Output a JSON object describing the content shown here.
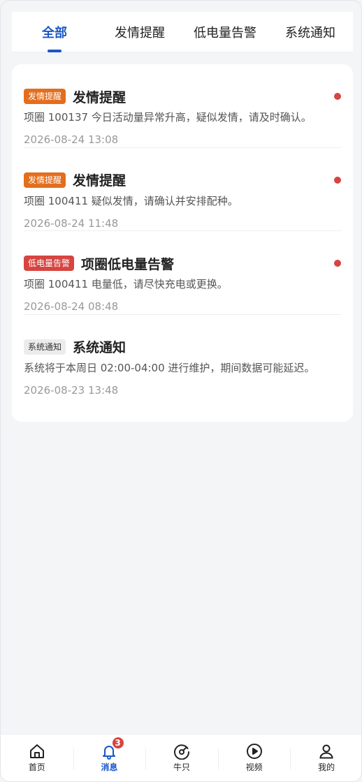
{
  "tabs": [
    {
      "label": "全部",
      "active": true
    },
    {
      "label": "发情提醒",
      "active": false
    },
    {
      "label": "低电量告警",
      "active": false
    },
    {
      "label": "系统通知",
      "active": false
    }
  ],
  "messages": [
    {
      "tag": "发情提醒",
      "title": "发情提醒",
      "body": "项圈 100137 今日活动量异常升高，疑似发情，请及时确认。",
      "time": "2026-08-24 13:08",
      "unread": true
    },
    {
      "tag": "发情提醒",
      "title": "发情提醒",
      "body": "项圈 100411 疑似发情，请确认并安排配种。",
      "time": "2026-08-24 11:48",
      "unread": true
    },
    {
      "tag": "低电量告警",
      "title": "项圈低电量告警",
      "body": "项圈 100411 电量低，请尽快充电或更换。",
      "time": "2026-08-24 08:48",
      "unread": true
    },
    {
      "tag": "系统通知",
      "title": "系统通知",
      "body": "系统将于本周日 02:00-04:00 进行维护，期间数据可能延迟。",
      "time": "2026-08-23 13:48",
      "unread": false
    }
  ],
  "nav": [
    {
      "label": "首页",
      "icon": "home-icon"
    },
    {
      "label": "消息",
      "icon": "bell-icon",
      "badge": "3",
      "active": true
    },
    {
      "label": "牛只",
      "icon": "gauge-icon"
    },
    {
      "label": "视频",
      "icon": "play-icon"
    },
    {
      "label": "我的",
      "icon": "user-icon"
    }
  ],
  "colors": {
    "accent": "#1a56c8",
    "estrus_tag": "#e36e1d",
    "battery_tag": "#d64541",
    "system_tag": "#ececec",
    "unread_dot": "#d64541"
  }
}
